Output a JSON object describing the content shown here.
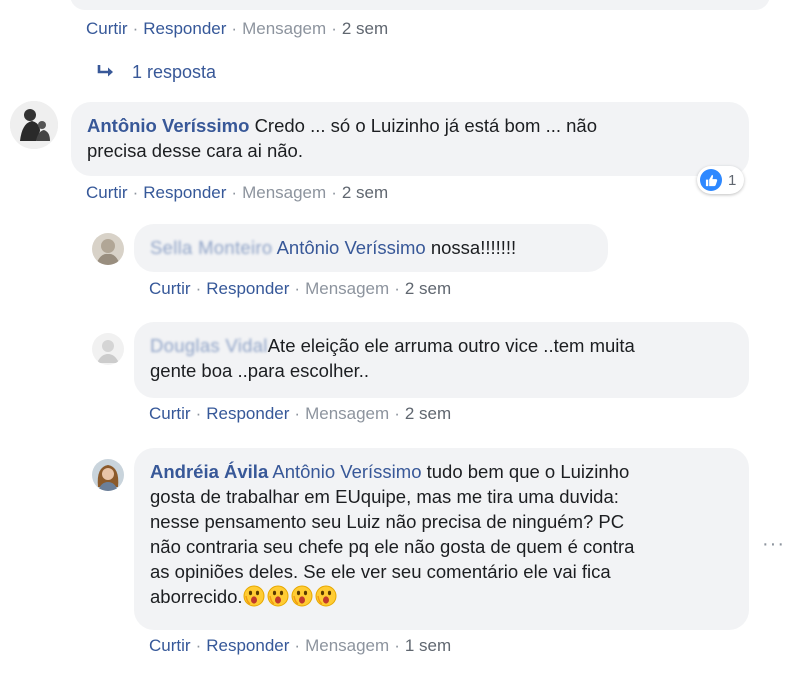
{
  "actions": {
    "like": "Curtir",
    "reply": "Responder",
    "message": "Mensagem",
    "sep": "·"
  },
  "top_actions": {
    "time": "2 sem"
  },
  "replies_link": {
    "label": "1 resposta"
  },
  "comments": [
    {
      "author": "Antônio Veríssimo",
      "text_line1": "Credo ... só o Luizinho já está bom ... não",
      "text_line2": "precisa desse cara ai não.",
      "time": "2 sem",
      "reaction_count": "1"
    },
    {
      "author_blurred": "Sella Monteiro",
      "mention": "Antônio Veríssimo",
      "text": "nossa!!!!!!!",
      "time": "2 sem"
    },
    {
      "author_blurred": "Douglas Vidal",
      "text_line1": "Ate eleição ele arruma outro vice ..tem muita",
      "text_line2": "gente boa ..para escolher..",
      "time": "2 sem"
    },
    {
      "author": "Andréia Ávila",
      "mention": "Antônio Veríssimo",
      "text_line1": "tudo bem que o Luizinho",
      "text_line2": "gosta de trabalhar em EUquipe, mas me tira uma duvida:",
      "text_line3": "nesse pensamento seu Luiz não precisa de ninguém? PC",
      "text_line4": "não contraria seu chefe pq ele não gosta de quem é contra",
      "text_line5": "as opiniões deles. Se ele ver seu comentário ele vai fica",
      "text_line6": "aborrecido.",
      "emoji": "astonished-face-icon",
      "time": "1 sem"
    }
  ],
  "more_menu": {
    "label": "···"
  },
  "colors": {
    "link": "#385898",
    "bubble": "#f2f3f5",
    "muted": "#8d949e",
    "like_blue": "#2d88ff"
  }
}
